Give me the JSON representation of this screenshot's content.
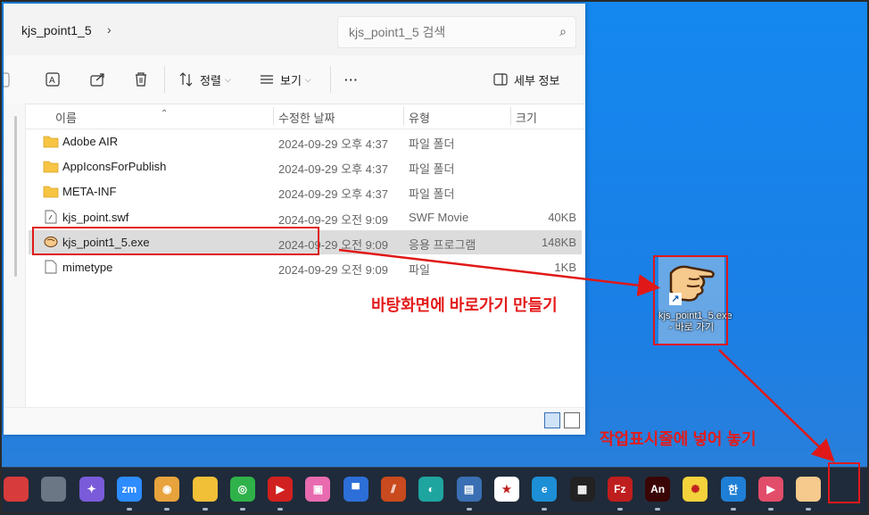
{
  "window": {
    "breadcrumb": "kjs_point1_5",
    "search_placeholder": "kjs_point1_5 검색"
  },
  "toolbar": {
    "sort_label": "정렬",
    "view_label": "보기",
    "more_label": "···",
    "details_label": "세부 정보"
  },
  "columns": {
    "name": "이름",
    "date": "수정한 날짜",
    "type": "유형",
    "size": "크기"
  },
  "files": [
    {
      "name": "Adobe AIR",
      "date": "2024-09-29 오후 4:37",
      "type": "파일 폴더",
      "size": "",
      "icon": "folder-icon"
    },
    {
      "name": "AppIconsForPublish",
      "date": "2024-09-29 오후 4:37",
      "type": "파일 폴더",
      "size": "",
      "icon": "folder-icon"
    },
    {
      "name": "META-INF",
      "date": "2024-09-29 오후 4:37",
      "type": "파일 폴더",
      "size": "",
      "icon": "folder-icon"
    },
    {
      "name": "kjs_point.swf",
      "date": "2024-09-29 오전 9:09",
      "type": "SWF Movie",
      "size": "40KB",
      "icon": "swf-file-icon"
    },
    {
      "name": "kjs_point1_5.exe",
      "date": "2024-09-29 오전 9:09",
      "type": "응용 프로그램",
      "size": "148KB",
      "icon": "hand-app-icon"
    },
    {
      "name": "mimetype",
      "date": "2024-09-29 오전 9:09",
      "type": "파일",
      "size": "1KB",
      "icon": "file-icon"
    }
  ],
  "desktop": {
    "shortcut_label": "kjs_point1_5.exe - 바로 가기"
  },
  "annotations": {
    "make_shortcut": "바탕화면에 바로가기 만들기",
    "pin_taskbar": "작업표시줄에 넣어 놓기"
  },
  "taskbar": {
    "apps": [
      {
        "name": "taskbar-app-red-icon",
        "color": "#d83b3b",
        "glyph": ""
      },
      {
        "name": "taskbar-app-gray-icon",
        "color": "#6b7785",
        "glyph": ""
      },
      {
        "name": "taskbar-copilot-icon",
        "color": "#7a5bd9",
        "glyph": "✦"
      },
      {
        "name": "taskbar-zoom-icon",
        "color": "#2d8cff",
        "glyph": "zm"
      },
      {
        "name": "taskbar-chrome-icon",
        "color": "#e8a33d",
        "glyph": "◉"
      },
      {
        "name": "taskbar-folder-icon",
        "color": "#f2c037",
        "glyph": ""
      },
      {
        "name": "taskbar-green-app-icon",
        "color": "#2fb24a",
        "glyph": "◎"
      },
      {
        "name": "taskbar-youtube-music-icon",
        "color": "#d12020",
        "glyph": "▶"
      },
      {
        "name": "taskbar-gift-icon",
        "color": "#e86bb0",
        "glyph": "▣"
      },
      {
        "name": "taskbar-blue-app-icon",
        "color": "#2d6fd8",
        "glyph": "▀"
      },
      {
        "name": "taskbar-bars-app-icon",
        "color": "#c94a1e",
        "glyph": "⫽"
      },
      {
        "name": "taskbar-teal-app-icon",
        "color": "#1fa5a0",
        "glyph": "◐"
      },
      {
        "name": "taskbar-save-icon",
        "color": "#3a6fb3",
        "glyph": "▤"
      },
      {
        "name": "taskbar-star-app-icon",
        "color": "#ffffff",
        "glyph": "★"
      },
      {
        "name": "taskbar-edge-icon",
        "color": "#1d8fd6",
        "glyph": "e"
      },
      {
        "name": "taskbar-pixel-app-icon",
        "color": "#222222",
        "glyph": "▦"
      },
      {
        "name": "taskbar-filezilla-icon",
        "color": "#bf1e1e",
        "glyph": "Fz"
      },
      {
        "name": "taskbar-animate-icon",
        "color": "#3a0505",
        "glyph": "An"
      },
      {
        "name": "taskbar-react-icon",
        "color": "#f3d23b",
        "glyph": "✺"
      },
      {
        "name": "taskbar-hangul-icon",
        "color": "#1f7fd6",
        "glyph": "한"
      },
      {
        "name": "taskbar-media-icon",
        "color": "#e24d6a",
        "glyph": "▶"
      },
      {
        "name": "taskbar-kjs-point-icon",
        "color": "#f6c98c",
        "glyph": ""
      }
    ]
  },
  "colors": {
    "annotation": "#e01818",
    "desktop": "#1a7fe6",
    "taskbar": "#1f2b3a"
  }
}
